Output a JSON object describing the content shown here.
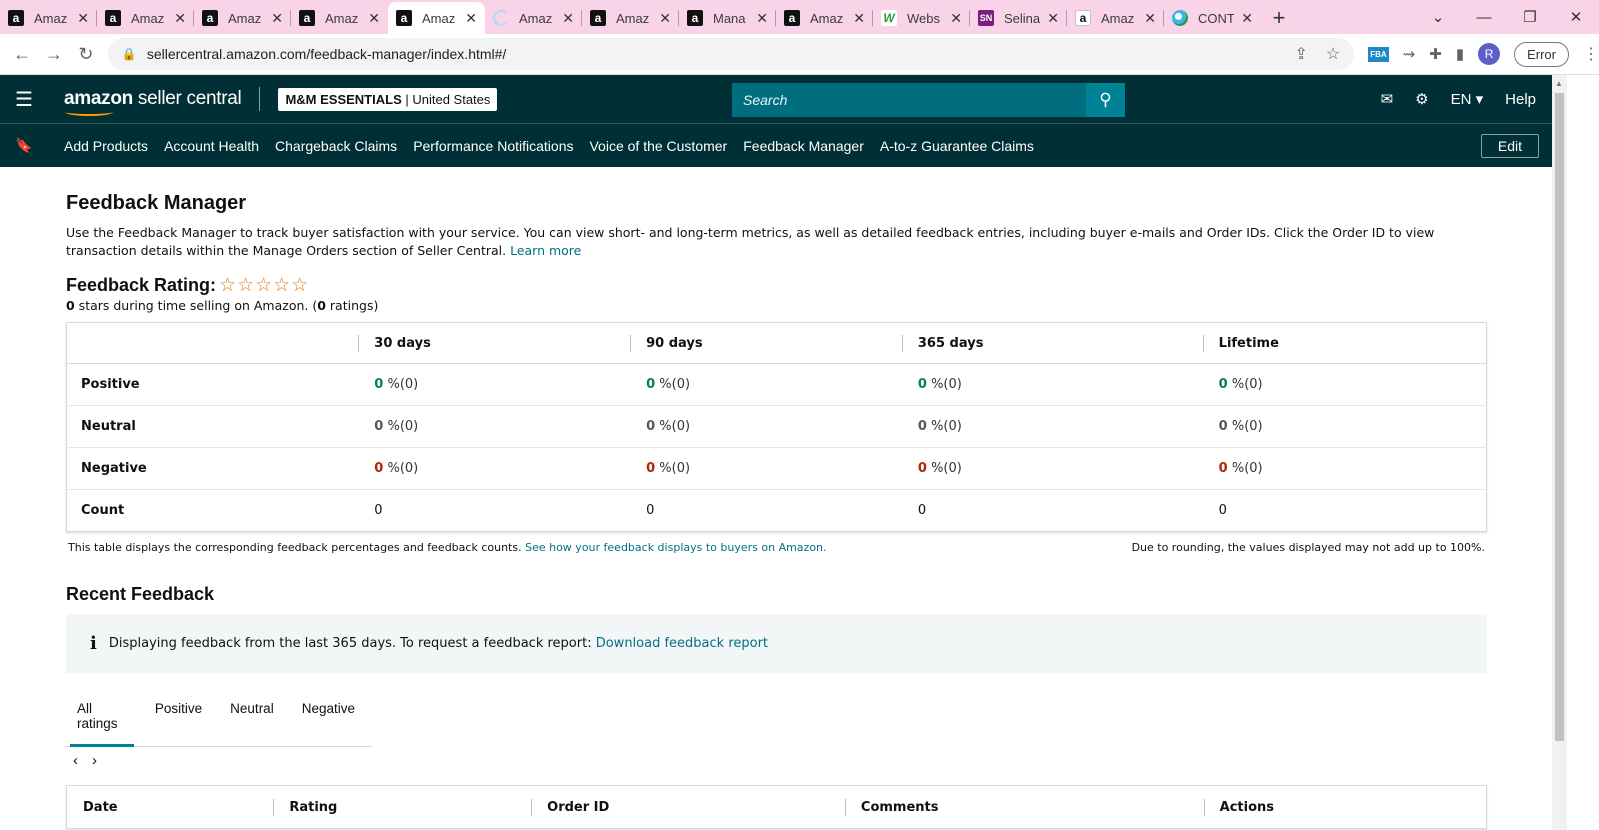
{
  "browser": {
    "tabs": [
      {
        "title": "Amaz",
        "icon": "amazon-icon"
      },
      {
        "title": "Amaz",
        "icon": "amazon-icon"
      },
      {
        "title": "Amaz",
        "icon": "amazon-icon"
      },
      {
        "title": "Amaz",
        "icon": "amazon-icon"
      },
      {
        "title": "Amaz",
        "icon": "amazon-icon",
        "active": true
      },
      {
        "title": "Amaz",
        "icon": "loading-icon"
      },
      {
        "title": "Amaz",
        "icon": "amazon-icon"
      },
      {
        "title": "Mana",
        "icon": "amazon-icon"
      },
      {
        "title": "Amaz",
        "icon": "amazon-icon"
      },
      {
        "title": "Webs",
        "icon": "website-icon"
      },
      {
        "title": "Selina",
        "icon": "sn-icon"
      },
      {
        "title": "Amaz",
        "icon": "amazon-icon"
      },
      {
        "title": "CONT",
        "icon": "edge-icon"
      }
    ],
    "url": "sellercentral.amazon.com/feedback-manager/index.html#/",
    "profile_initial": "R",
    "error_label": "Error",
    "ext_fba": "FBA"
  },
  "header": {
    "brand_main": "amazon",
    "brand_sub": " seller central",
    "store_name": "M&M ESSENTIALS",
    "store_sep": " | ",
    "store_region": "United States",
    "search_placeholder": "Search",
    "language": "EN",
    "help": "Help"
  },
  "nav": {
    "links": [
      "Add Products",
      "Account Health",
      "Chargeback Claims",
      "Performance Notifications",
      "Voice of the Customer",
      "Feedback Manager",
      "A-to-z Guarantee Claims"
    ],
    "edit": "Edit"
  },
  "page": {
    "title": "Feedback Manager",
    "intro": "Use the Feedback Manager to track buyer satisfaction with your service. You can view short- and long-term metrics, as well as detailed feedback entries, including buyer e-mails and Order IDs. Click the Order ID to view transaction details within the Manage Orders section of Seller Central.",
    "learn_more": "Learn more",
    "rating_title": "Feedback Rating:",
    "rating_stars": 0,
    "rating_max": 5,
    "rating_stars_value": "0",
    "rating_sub_middle": " stars during time selling on Amazon. (",
    "rating_count": "0",
    "rating_sub_end": " ratings)"
  },
  "metrics": {
    "columns": [
      "30 days",
      "90 days",
      "365 days",
      "Lifetime"
    ],
    "pct_suffix": "%(0)",
    "rows": {
      "positive": {
        "label": "Positive",
        "values": [
          "0",
          "0",
          "0",
          "0"
        ]
      },
      "neutral": {
        "label": "Neutral",
        "values": [
          "0",
          "0",
          "0",
          "0"
        ]
      },
      "negative": {
        "label": "Negative",
        "values": [
          "0",
          "0",
          "0",
          "0"
        ]
      },
      "count": {
        "label": "Count",
        "values": [
          "0",
          "0",
          "0",
          "0"
        ]
      }
    },
    "note_left": "This table displays the corresponding feedback percentages and feedback counts. ",
    "note_link": "See how your feedback displays to buyers on Amazon.",
    "note_right": "Due to rounding, the values displayed may not add up to 100%."
  },
  "recent": {
    "title": "Recent Feedback",
    "info_text": "Displaying feedback from the last 365 days. To request a feedback report: ",
    "info_link": "Download feedback report",
    "tabs": [
      "All ratings",
      "Positive",
      "Neutral",
      "Negative"
    ],
    "columns": [
      "Date",
      "Rating",
      "Order ID",
      "Comments",
      "Actions"
    ]
  },
  "colors": {
    "header_bg": "#002f36",
    "search_bg": "#006e7f",
    "link": "#007185",
    "positive": "#067d62",
    "negative": "#b12704",
    "tab_strip": "#f9d3e8"
  }
}
